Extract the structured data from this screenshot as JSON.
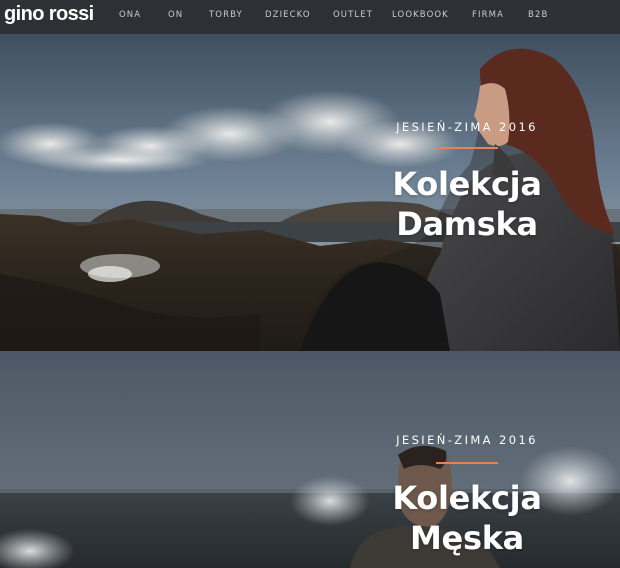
{
  "header": {
    "logo": "gino rossi",
    "nav": [
      "ONA",
      "ON",
      "TORBY",
      "DZIECKO",
      "OUTLET",
      "LOOKBOOK",
      "FIRMA",
      "B2B"
    ]
  },
  "banners": [
    {
      "season": "JESIEŃ-ZIMA 2016",
      "title_line1": "Kolekcja",
      "title_line2": "Damska"
    },
    {
      "season": "JESIEŃ-ZIMA 2016",
      "title_line1": "Kolekcja",
      "title_line2": "Męska"
    }
  ],
  "colors": {
    "header_bg": "#2d3136",
    "accent_rule": "#e3835a",
    "nav_text": "#c9ccd0"
  }
}
